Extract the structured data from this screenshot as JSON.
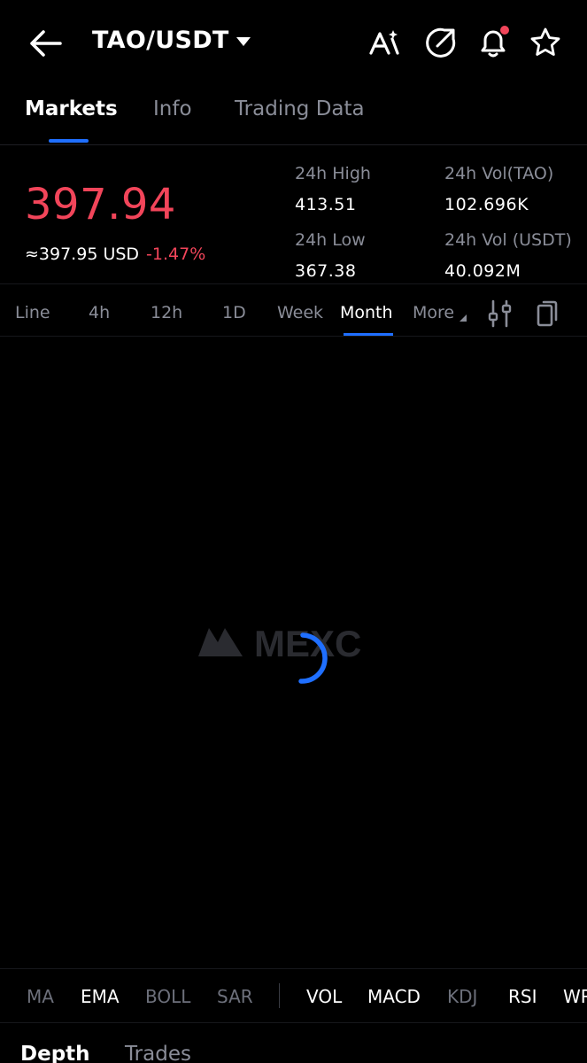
{
  "header": {
    "pair": "TAO/USDT",
    "icons": [
      "back-arrow-icon",
      "caret-down-icon",
      "ai-icon",
      "share-icon",
      "bell-icon",
      "star-icon"
    ],
    "notification_dot_color": "#f2455a"
  },
  "tabs": [
    {
      "label": "Markets",
      "active": true
    },
    {
      "label": "Info",
      "active": false
    },
    {
      "label": "Trading Data",
      "active": false
    }
  ],
  "ticker": {
    "last_price": "397.94",
    "usd_equivalent": "≈397.95 USD",
    "change_pct": "-1.47%",
    "stats": {
      "high_label": "24h High",
      "high_value": "413.51",
      "low_label": "24h Low",
      "low_value": "367.38",
      "vol_base_label": "24h Vol(TAO)",
      "vol_base_value": "102.696K",
      "vol_quote_label": "24h Vol (USDT)",
      "vol_quote_value": "40.092M"
    }
  },
  "intervals": {
    "items": [
      "Line",
      "4h",
      "12h",
      "1D",
      "Week",
      "Month",
      "More"
    ],
    "active": "Month",
    "icons": [
      "settings-sliders-icon",
      "copy-layout-icon"
    ]
  },
  "chart": {
    "watermark": "MEXC",
    "loading": true
  },
  "indicators": {
    "main": [
      {
        "label": "MA",
        "on": false
      },
      {
        "label": "EMA",
        "on": true
      },
      {
        "label": "BOLL",
        "on": false
      },
      {
        "label": "SAR",
        "on": false
      }
    ],
    "sub": [
      {
        "label": "VOL",
        "on": true
      },
      {
        "label": "MACD",
        "on": true
      },
      {
        "label": "KDJ",
        "on": false
      },
      {
        "label": "RSI",
        "on": true
      },
      {
        "label": "WR",
        "on": true
      }
    ]
  },
  "bottom_tabs": [
    {
      "label": "Depth",
      "active": true
    },
    {
      "label": "Trades",
      "active": false
    }
  ],
  "colors": {
    "accent": "#1f6fff",
    "down": "#f2455a",
    "muted": "#8a8d98",
    "background": "#000000"
  }
}
